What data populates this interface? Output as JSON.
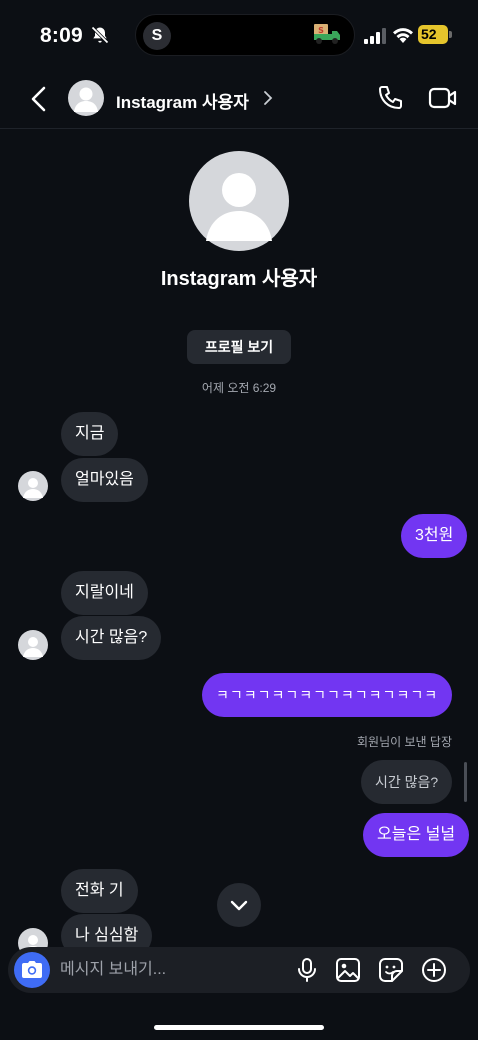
{
  "status_bar": {
    "time": "8:09",
    "island_badge": "S",
    "battery": "52",
    "icons": [
      "bell-off-icon",
      "truck-icon",
      "signal-icon",
      "wifi-icon",
      "battery-icon"
    ]
  },
  "header": {
    "title": "Instagram 사용자",
    "icons": [
      "back-icon",
      "avatar",
      "chevron-right-icon",
      "phone-icon",
      "video-icon"
    ]
  },
  "profile": {
    "name": "Instagram 사용자",
    "view_profile_label": "프로필 보기"
  },
  "timestamp": "어제 오전 6:29",
  "messages": [
    {
      "from": "them",
      "text": "지금"
    },
    {
      "from": "them",
      "text": "얼마있음"
    },
    {
      "from": "me",
      "text": "3천원"
    },
    {
      "from": "them",
      "text": "지랄이네"
    },
    {
      "from": "them",
      "text": "시간 많음?"
    },
    {
      "from": "me",
      "text": "ㅋㄱㅋㄱㅋㄱㅋㄱㄱㅋㄱㅋㄱㅋㄱㅋ"
    },
    {
      "from": "me",
      "text": "오늘은 널널",
      "reply_label": "회원님이 보낸 답장",
      "reply_to": "시간 많음?"
    },
    {
      "from": "them",
      "text": "전화 기"
    },
    {
      "from": "them",
      "text": "나 심심함"
    }
  ],
  "composer": {
    "placeholder": "메시지 보내기...",
    "icons": [
      "camera-icon",
      "mic-icon",
      "gallery-icon",
      "sticker-icon",
      "plus-icon"
    ]
  },
  "colors": {
    "background": "#0c0f14",
    "incoming_bubble": "#262a31",
    "outgoing_bubble": "#7236f2",
    "camera_button": "#3f6cf5",
    "battery": "#e6c52c"
  }
}
